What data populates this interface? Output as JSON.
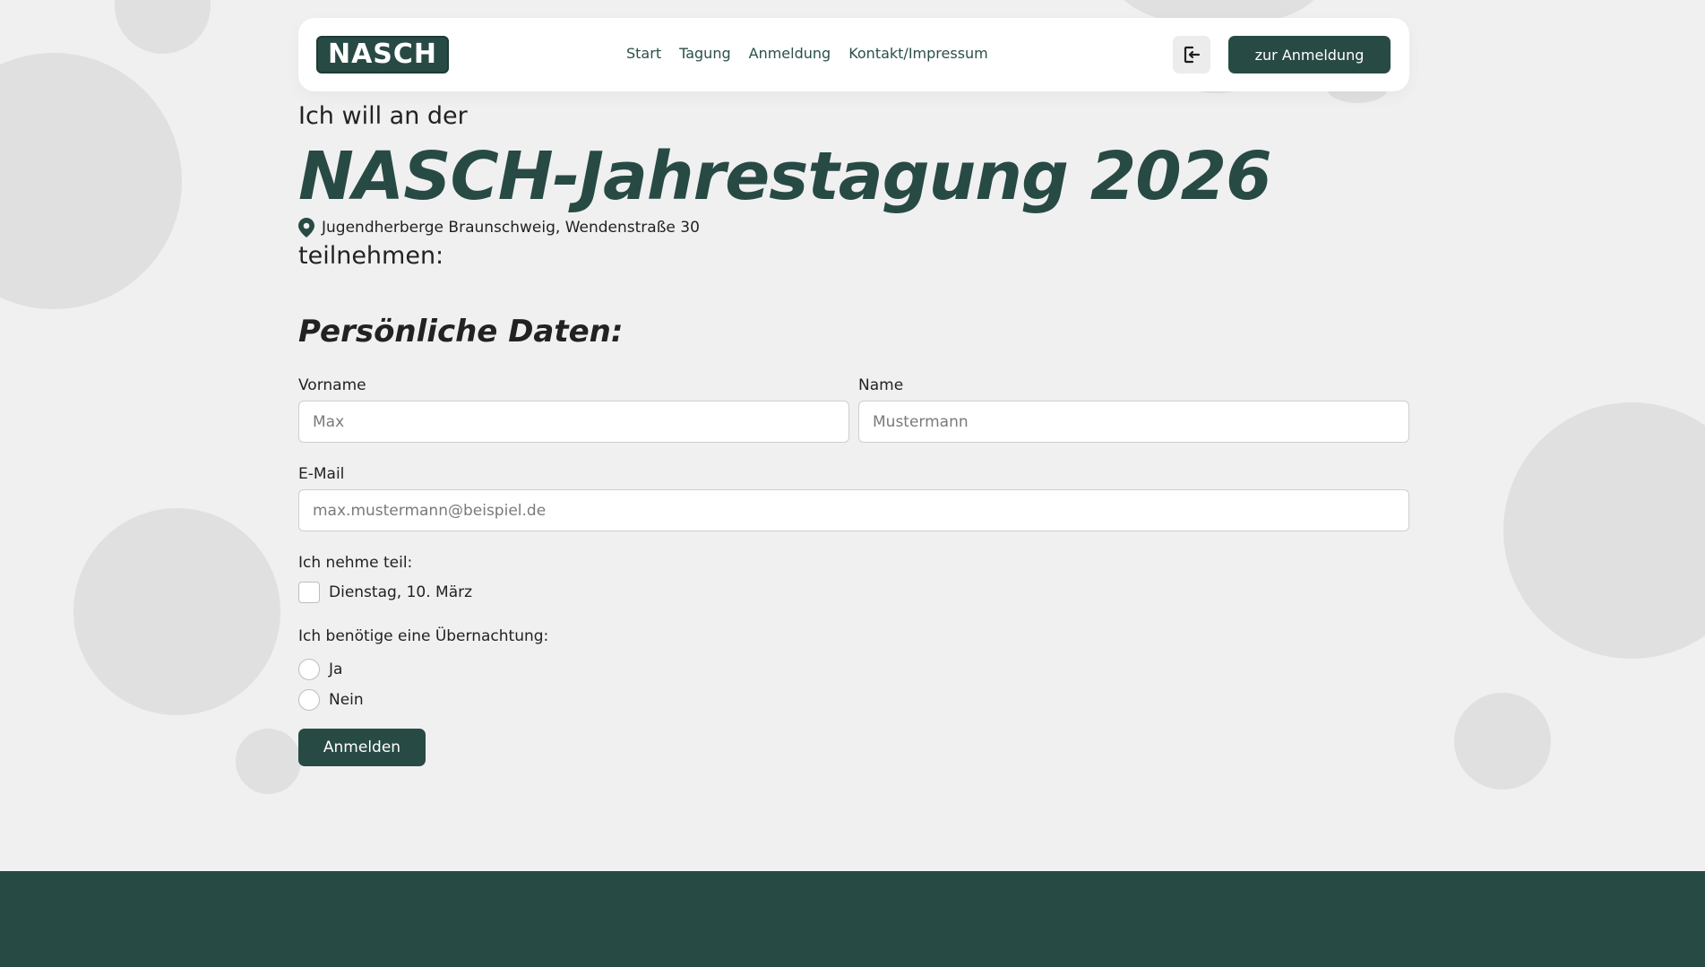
{
  "colors": {
    "primary": "#284a44",
    "background": "#f0f0f0",
    "bubble": "#e0e0e0"
  },
  "header": {
    "logo_text": "NASCH",
    "nav": [
      "Start",
      "Tagung",
      "Anmeldung",
      "Kontakt/Impressum"
    ],
    "login_icon": "logout-icon",
    "cta_label": "zur Anmeldung"
  },
  "hero": {
    "intro_line1": "Ich will an der",
    "title": "NASCH-Jahrestagung 2026",
    "location_icon": "map-pin-icon",
    "location": "Jugendherberge Braunschweig, Wendenstraße 30",
    "intro_line2": "teilnehmen:"
  },
  "form": {
    "section_title": "Persönliche Daten:",
    "firstname": {
      "label": "Vorname",
      "placeholder": "Max"
    },
    "lastname": {
      "label": "Name",
      "placeholder": "Mustermann"
    },
    "email": {
      "label": "E-Mail",
      "placeholder": "max.mustermann@beispiel.de"
    },
    "participation": {
      "label": "Ich nehme teil:",
      "options": [
        "Dienstag, 10. März"
      ]
    },
    "overnight": {
      "label": "Ich benötige eine Übernachtung:",
      "options": [
        "Ja",
        "Nein"
      ]
    },
    "submit_label": "Anmelden"
  }
}
